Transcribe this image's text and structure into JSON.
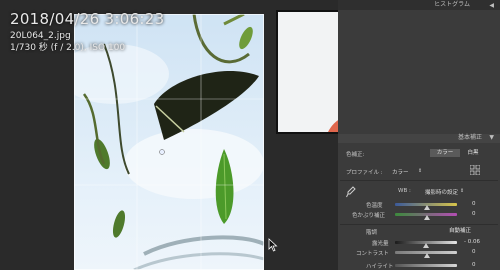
{
  "photo_info": {
    "capture_time": "2018/04/26 3:06:23",
    "file_name": "20L064_2.jpg",
    "exposure": "1/730 秒 (f / 2.0), ISO 100"
  },
  "panels": {
    "histogram_label": "ヒストグラム",
    "basic_label": "基本補正"
  },
  "basic": {
    "treatment_label": "色補正:",
    "color_option": "カラー",
    "bw_option": "白黒",
    "profile_label": "プロファイル :",
    "profile_value": "カラー",
    "wb_label": "WB :",
    "wb_value": "撮影時の設定",
    "temp_label": "色温度",
    "temp_value": "0",
    "tint_label": "色かぶり補正",
    "tint_value": "0",
    "tone_label": "階調",
    "auto_label": "自動補正",
    "exposure_label": "露光量",
    "exposure_value": "- 0.06",
    "contrast_label": "コントラスト",
    "contrast_value": "0",
    "highlights_label": "ハイライト",
    "highlights_value": "0"
  },
  "colors": {
    "panel_bg": "#3b3b3b",
    "selected_option": "#5a5a5a"
  }
}
